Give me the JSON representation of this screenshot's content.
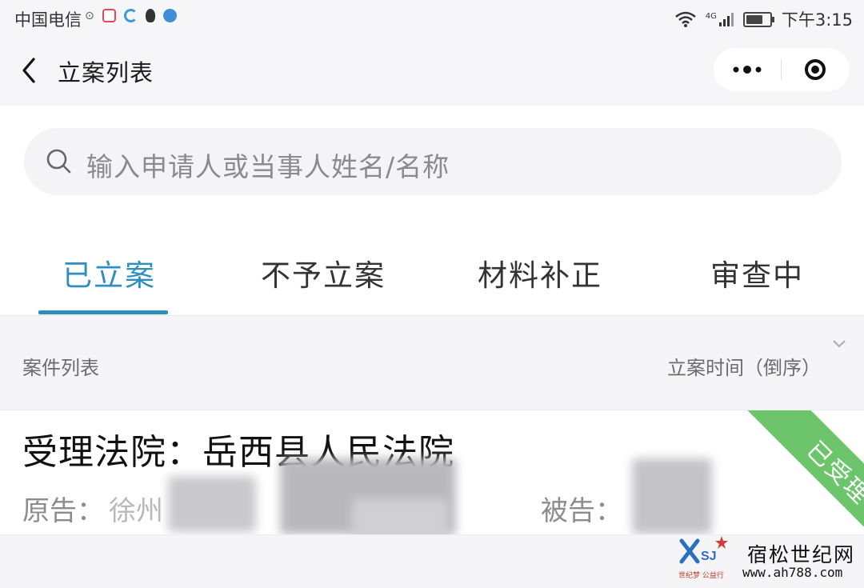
{
  "status_bar": {
    "carrier": "中国电信",
    "network": "4G",
    "time": "下午3:15"
  },
  "nav": {
    "title": "立案列表",
    "more_icon": "more-dots-icon",
    "close_icon": "target-close-icon"
  },
  "search": {
    "placeholder": "输入申请人或当事人姓名/名称"
  },
  "tabs": [
    {
      "label": "已立案",
      "active": true
    },
    {
      "label": "不予立案",
      "active": false
    },
    {
      "label": "材料补正",
      "active": false
    },
    {
      "label": "审查中",
      "active": false
    }
  ],
  "list_header": {
    "title": "案件列表",
    "sort_label": "立案时间（倒序）"
  },
  "cases": [
    {
      "court_line": "受理法院：岳西县人民法院",
      "plaintiff_label": "原告：",
      "plaintiff_value": "徐州",
      "defendant_label": "被告：",
      "status": "已受理"
    }
  ],
  "watermark": {
    "name": "宿松世纪网",
    "url": "www.ah788.com",
    "tagline": "世纪梦 公益行"
  },
  "colors": {
    "accent": "#2e8fbf",
    "status_ribbon": "#6cc56a"
  }
}
